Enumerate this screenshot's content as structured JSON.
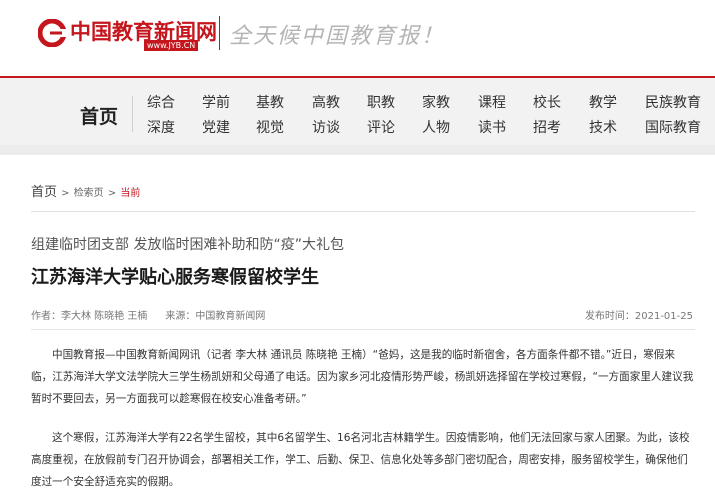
{
  "header": {
    "logo_name": "中国教育新闻网",
    "logo_url": "www.JYB.CN",
    "slogan": "全天候中国教育报！"
  },
  "nav": {
    "home": "首页",
    "row1": [
      "综合",
      "学前",
      "基教",
      "高教",
      "职教",
      "家教",
      "课程",
      "校长",
      "教学",
      "民族教育"
    ],
    "row2": [
      "深度",
      "党建",
      "视觉",
      "访谈",
      "评论",
      "人物",
      "读书",
      "招考",
      "技术",
      "国际教育"
    ]
  },
  "breadcrumb": {
    "home": "首页",
    "middle": "检索页",
    "current": "当前"
  },
  "article": {
    "subtitle": "组建临时团支部 发放临时困难补助和防“疫”大礼包",
    "title": "江苏海洋大学贴心服务寒假留校学生",
    "author": "作者：李大林 陈晓艳 王楠",
    "source": "来源：中国教育新闻网",
    "date": "发布时间：2021-01-25",
    "paragraphs": [
      "中国教育报—中国教育新闻网讯（记者 李大林 通讯员 陈晓艳 王楠）“爸妈，这是我的临时新宿舍，各方面条件都不错。”近日，寒假来临，江苏海洋大学文法学院大三学生杨凯妍和父母通了电话。因为家乡河北疫情形势严峻，杨凯妍选择留在学校过寒假，“一方面家里人建议我暂时不要回去，另一方面我可以趁寒假在校安心准备考研。”",
      "这个寒假，江苏海洋大学有22名学生留校，其中6名留学生、16名河北吉林籍学生。因疫情影响，他们无法回家与家人团聚。为此，该校高度重视，在放假前专门召开协调会，部署相关工作，学工、后勤、保卫、信息化处等多部门密切配合，周密安排，服务留校学生，确保他们度过一个安全舒适充实的假期。"
    ]
  },
  "colors": {
    "brand_red": "#c4161c"
  }
}
